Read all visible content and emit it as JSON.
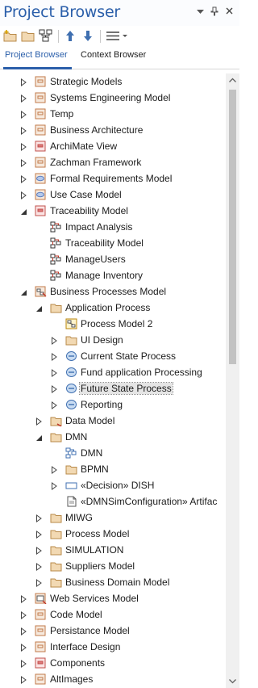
{
  "window": {
    "title": "Project Browser",
    "controls": {
      "dropdown_icon": "triangle-down",
      "pin_icon": "pin",
      "close_icon": "close-x"
    }
  },
  "toolbar": {
    "buttons": [
      {
        "name": "new-package-button",
        "icon": "new-package-icon"
      },
      {
        "name": "new-folder-button",
        "icon": "folder-icon"
      },
      {
        "name": "new-diagram-button",
        "icon": "diagram-icon"
      },
      {
        "name": "move-up-button",
        "icon": "arrow-up-icon"
      },
      {
        "name": "move-down-button",
        "icon": "arrow-down-icon"
      },
      {
        "name": "menu-button",
        "icon": "hamburger-menu-icon"
      }
    ]
  },
  "tabs": [
    {
      "label": "Project Browser",
      "active": true
    },
    {
      "label": "Context Browser",
      "active": false
    }
  ],
  "tree": [
    {
      "label": "Strategic Models",
      "level": 0,
      "expander": "collapsed",
      "icon": "package"
    },
    {
      "label": "Systems Engineering Model",
      "level": 0,
      "expander": "collapsed",
      "icon": "package"
    },
    {
      "label": "Temp",
      "level": 0,
      "expander": "collapsed",
      "icon": "package"
    },
    {
      "label": "Business Architecture",
      "level": 0,
      "expander": "collapsed",
      "icon": "package"
    },
    {
      "label": "ArchiMate View",
      "level": 0,
      "expander": "collapsed",
      "icon": "package-red"
    },
    {
      "label": "Zachman Framework",
      "level": 0,
      "expander": "collapsed",
      "icon": "package"
    },
    {
      "label": "Formal Requirements Model",
      "level": 0,
      "expander": "collapsed",
      "icon": "package-oval"
    },
    {
      "label": "Use Case Model",
      "level": 0,
      "expander": "collapsed",
      "icon": "package-oval"
    },
    {
      "label": "Traceability Model",
      "level": 0,
      "expander": "expanded",
      "icon": "package-red"
    },
    {
      "label": "Impact Analysis",
      "level": 1,
      "expander": "none",
      "icon": "trace-diagram"
    },
    {
      "label": "Traceability Model",
      "level": 1,
      "expander": "none",
      "icon": "trace-diagram"
    },
    {
      "label": "ManageUsers",
      "level": 1,
      "expander": "none",
      "icon": "trace-diagram"
    },
    {
      "label": "Manage Inventory",
      "level": 1,
      "expander": "none",
      "icon": "trace-diagram"
    },
    {
      "label": "Business Processes Model",
      "level": 0,
      "expander": "expanded",
      "icon": "package-process"
    },
    {
      "label": "Application Process",
      "level": 1,
      "expander": "expanded",
      "icon": "folder"
    },
    {
      "label": "Process Model 2",
      "level": 2,
      "expander": "none",
      "icon": "process-diagram"
    },
    {
      "label": "UI Design",
      "level": 2,
      "expander": "collapsed",
      "icon": "folder"
    },
    {
      "label": "Current State Process",
      "level": 2,
      "expander": "collapsed",
      "icon": "process"
    },
    {
      "label": "Fund application Processing",
      "level": 2,
      "expander": "collapsed",
      "icon": "process"
    },
    {
      "label": "Future State Process",
      "level": 2,
      "expander": "collapsed",
      "icon": "process",
      "selected": true
    },
    {
      "label": "Reporting",
      "level": 2,
      "expander": "collapsed",
      "icon": "process"
    },
    {
      "label": "Data Model",
      "level": 1,
      "expander": "collapsed",
      "icon": "folder-red"
    },
    {
      "label": "DMN",
      "level": 1,
      "expander": "expanded",
      "icon": "folder"
    },
    {
      "label": "DMN",
      "level": 2,
      "expander": "none",
      "icon": "dmn-diagram"
    },
    {
      "label": "BPMN",
      "level": 2,
      "expander": "collapsed",
      "icon": "folder"
    },
    {
      "label": "«Decision» DISH",
      "level": 2,
      "expander": "collapsed",
      "icon": "decision"
    },
    {
      "label": "«DMNSimConfiguration» Artifac",
      "level": 2,
      "expander": "none",
      "icon": "artifact"
    },
    {
      "label": "MIWG",
      "level": 1,
      "expander": "collapsed",
      "icon": "folder"
    },
    {
      "label": "Process Model",
      "level": 1,
      "expander": "collapsed",
      "icon": "folder"
    },
    {
      "label": "SIMULATION",
      "level": 1,
      "expander": "collapsed",
      "icon": "folder"
    },
    {
      "label": "Suppliers Model",
      "level": 1,
      "expander": "collapsed",
      "icon": "folder"
    },
    {
      "label": "Business Domain Model",
      "level": 1,
      "expander": "collapsed",
      "icon": "folder"
    },
    {
      "label": "Web Services Model",
      "level": 0,
      "expander": "collapsed",
      "icon": "package-web"
    },
    {
      "label": "Code Model",
      "level": 0,
      "expander": "collapsed",
      "icon": "package"
    },
    {
      "label": "Persistance Model",
      "level": 0,
      "expander": "collapsed",
      "icon": "package"
    },
    {
      "label": "Interface Design",
      "level": 0,
      "expander": "collapsed",
      "icon": "package"
    },
    {
      "label": "Components",
      "level": 0,
      "expander": "collapsed",
      "icon": "package-red"
    },
    {
      "label": "AltImages",
      "level": 0,
      "expander": "collapsed",
      "icon": "package"
    }
  ],
  "colors": {
    "title": "#2b5faa",
    "accent": "#2b5faa",
    "package_fill": "#f6e9dd",
    "package_stroke": "#c27a4a",
    "folder_fill": "#f2d9b3",
    "folder_stroke": "#b88a4a",
    "process_fill": "#c9dcf2",
    "process_stroke": "#3f6fb0"
  }
}
